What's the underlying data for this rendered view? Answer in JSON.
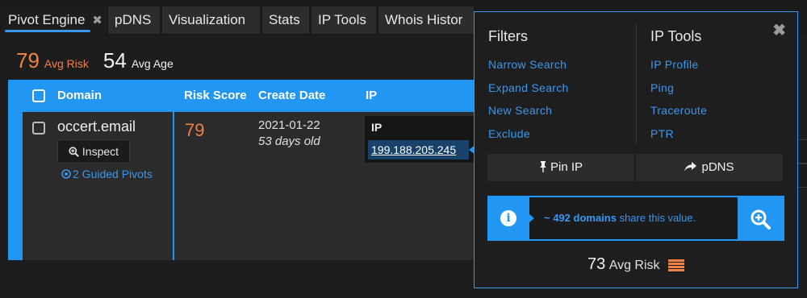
{
  "tabs": [
    {
      "label": "Pivot Engine",
      "close": "✖"
    },
    {
      "label": "pDNS"
    },
    {
      "label": "Visualization"
    },
    {
      "label": "Stats"
    },
    {
      "label": "IP Tools"
    },
    {
      "label": "Whois Histor"
    }
  ],
  "stats": {
    "avg_risk_value": "79",
    "avg_risk_label": "Avg Risk",
    "avg_age_value": "54",
    "avg_age_label": "Avg Age"
  },
  "table": {
    "headers": [
      "Domain",
      "Risk Score",
      "Create Date",
      "IP"
    ],
    "rows": [
      {
        "domain": "occert.email",
        "inspect_label": "Inspect",
        "guided_pivots": "2 Guided Pivots",
        "risk_score": "79",
        "create_date": "2021-01-22",
        "age": "53 days old",
        "ip_label": "IP",
        "ip_value": "199.188.205.245"
      }
    ]
  },
  "popover": {
    "close": "✖",
    "filters_title": "Filters",
    "filters": [
      "Narrow Search",
      "Expand Search",
      "New Search",
      "Exclude"
    ],
    "ip_tools_title": "IP Tools",
    "ip_tools": [
      "IP Profile",
      "Ping",
      "Traceroute",
      "PTR"
    ],
    "pin_label": "Pin IP",
    "pdns_label": "pDNS",
    "share_count": "~ 492 domains",
    "share_text": " share this value.",
    "avg_risk_value": "73",
    "avg_risk_label": "Avg Risk"
  },
  "colors": {
    "accent": "#2196f3",
    "link": "#3a97f0",
    "risk_orange": "#ef8046"
  },
  "icons": [
    "close-icon",
    "search-plus-icon",
    "pin-icon",
    "share-icon",
    "info-icon",
    "zoom-in-icon",
    "risk-bars-icon",
    "guided-pivot-icon"
  ]
}
